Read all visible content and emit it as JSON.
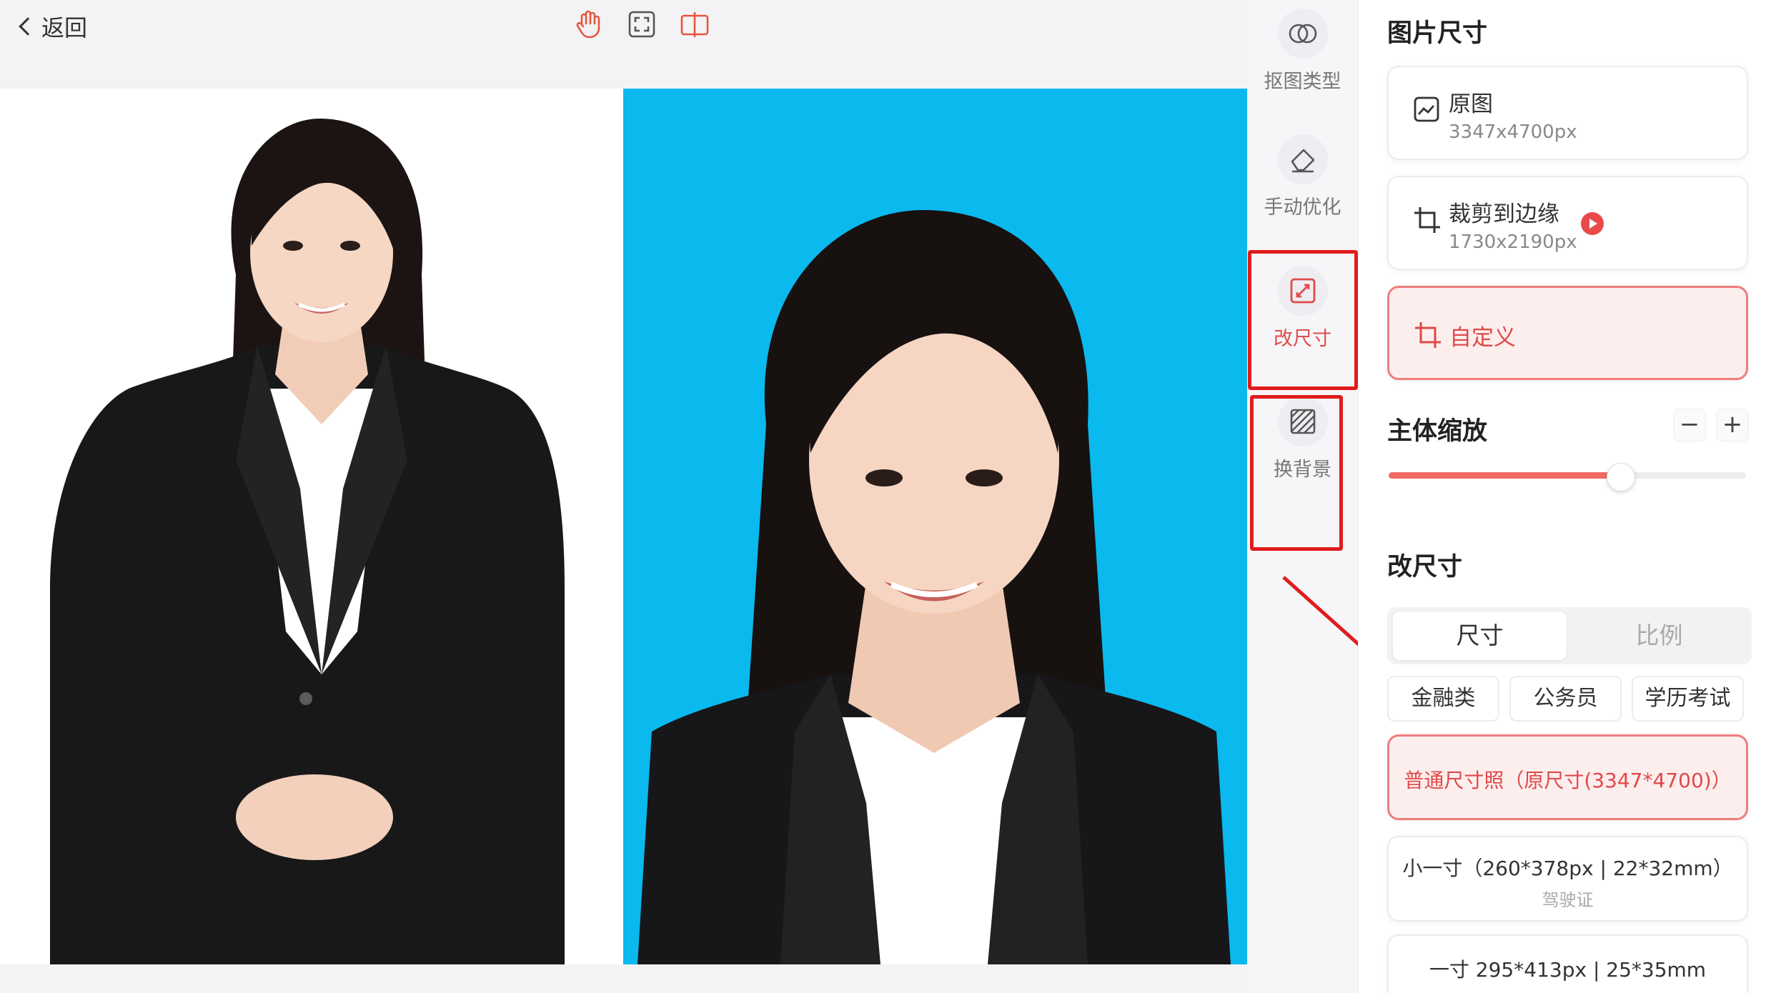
{
  "topbar": {
    "back_label": "返回"
  },
  "toolbar": {
    "tools": [
      "hand-icon",
      "fullscreen-icon",
      "compare-icon"
    ]
  },
  "tool_column": {
    "items": [
      {
        "label": "抠图类型",
        "icon": "cutout-icon"
      },
      {
        "label": "手动优化",
        "icon": "eraser-icon"
      },
      {
        "label": "改尺寸",
        "icon": "resize-icon",
        "active": true
      },
      {
        "label": "换背景",
        "icon": "background-icon"
      }
    ]
  },
  "panel": {
    "image_size": {
      "heading": "图片尺寸",
      "original": {
        "title": "原图",
        "size": "3347x4700px"
      },
      "crop": {
        "title": "裁剪到边缘",
        "size": "1730x2190px"
      },
      "custom": {
        "title": "自定义"
      }
    },
    "subject_scale": {
      "heading": "主体缩放",
      "minus": "−",
      "plus": "+",
      "value_fraction": 0.65
    },
    "resize": {
      "heading": "改尺寸",
      "tabs": [
        "尺寸",
        "比例"
      ],
      "categories": [
        "金融类",
        "公务员",
        "学历考试"
      ],
      "sizes": [
        {
          "label": "普通尺寸照（原尺寸(3347*4700)）",
          "note": "",
          "selected": true
        },
        {
          "label": "小一寸（260*378px | 22*32mm）",
          "note": "驾驶证"
        },
        {
          "label": "一寸 295*413px | 25*35mm",
          "note": ""
        }
      ]
    }
  },
  "colors": {
    "accent": "#e24b4b",
    "photo_bg_blue": "#0ab9ee",
    "highlight_red": "#e01c1c"
  }
}
